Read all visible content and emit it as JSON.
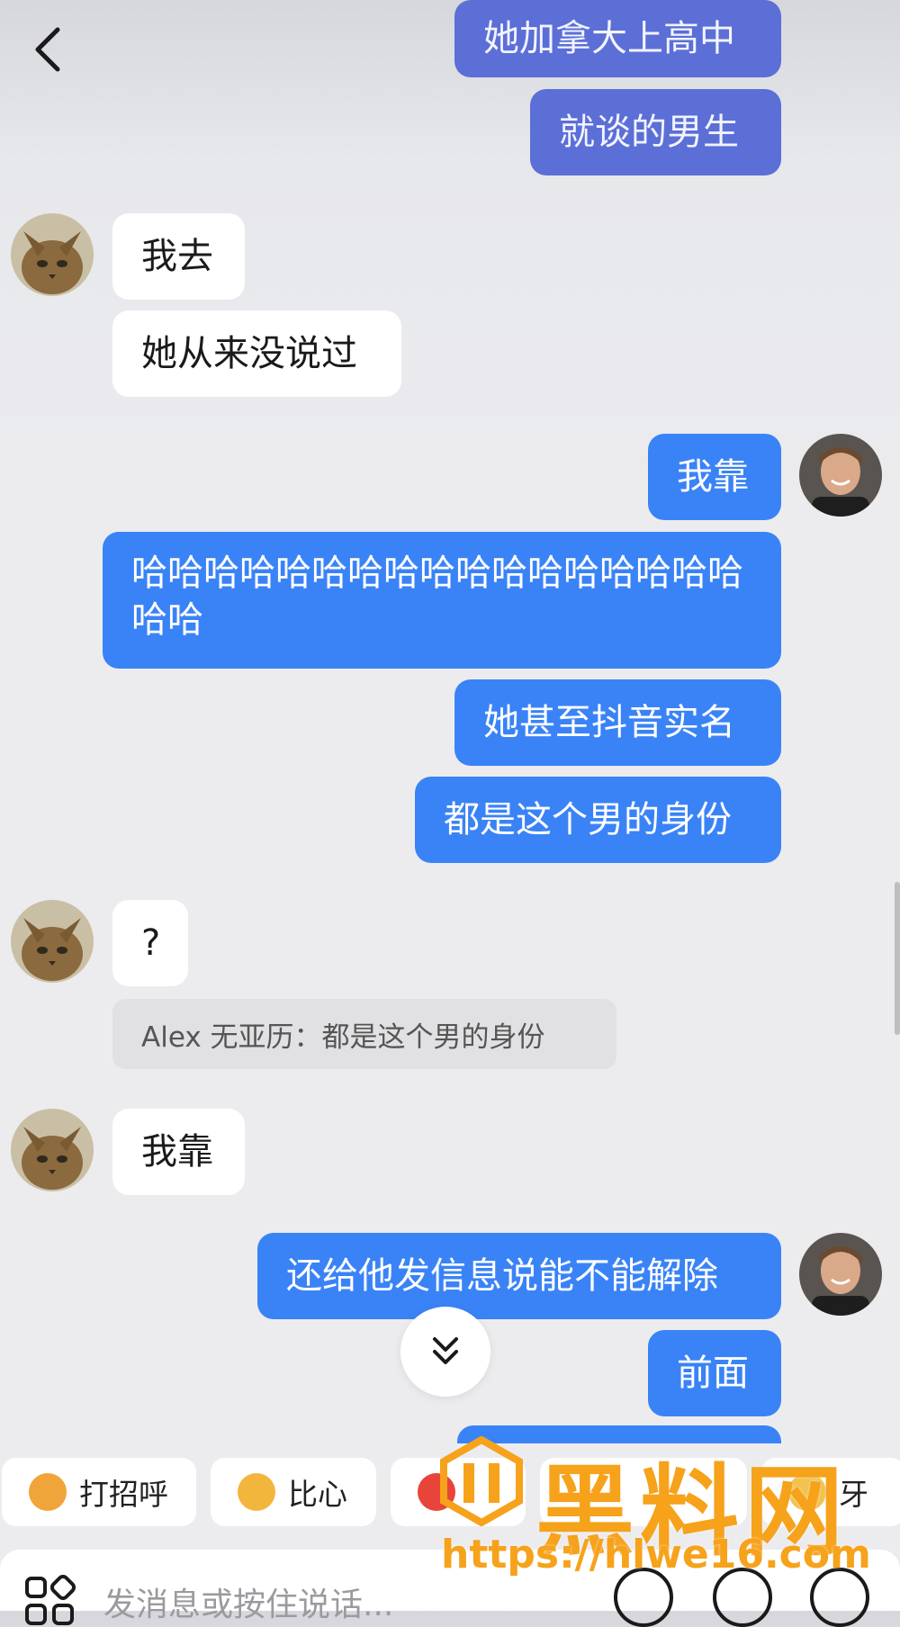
{
  "header": {
    "back_icon": "chevron-left-icon"
  },
  "messages": [
    {
      "dir": "out",
      "text": "她加拿大上高中"
    },
    {
      "dir": "out",
      "text": "就谈的男生"
    },
    {
      "dir": "in",
      "text": "我去"
    },
    {
      "dir": "in",
      "text": "她从来没说过"
    },
    {
      "dir": "out",
      "text": "我靠"
    },
    {
      "dir": "out",
      "text": "哈哈哈哈哈哈哈哈哈哈哈哈哈哈哈哈哈哈哈"
    },
    {
      "dir": "out",
      "text": "她甚至抖音实名"
    },
    {
      "dir": "out",
      "text": "都是这个男的身份"
    },
    {
      "dir": "in",
      "text": "?"
    },
    {
      "dir": "in",
      "text": "我靠"
    },
    {
      "dir": "out",
      "text": "还给他发信息说能不能解除"
    },
    {
      "dir": "out",
      "text": "前面"
    }
  ],
  "quote": {
    "text": "Alex 无亚历：都是这个男的身份"
  },
  "quick_replies": [
    {
      "label": "打招呼",
      "emoji_color": "#f0a53a"
    },
    {
      "label": "比心",
      "emoji_color": "#f3b63c"
    },
    {
      "label": "",
      "emoji_color": "#e8443a"
    },
    {
      "label": ""
    },
    {
      "label": "牙"
    }
  ],
  "input": {
    "placeholder": "发消息或按住说话..."
  },
  "watermark": {
    "title": "黑料网",
    "url": "https://hlwe16.com"
  },
  "colors": {
    "outgoing": "#3a83f7",
    "incoming": "#ffffff",
    "watermark": "#f6a21b"
  }
}
